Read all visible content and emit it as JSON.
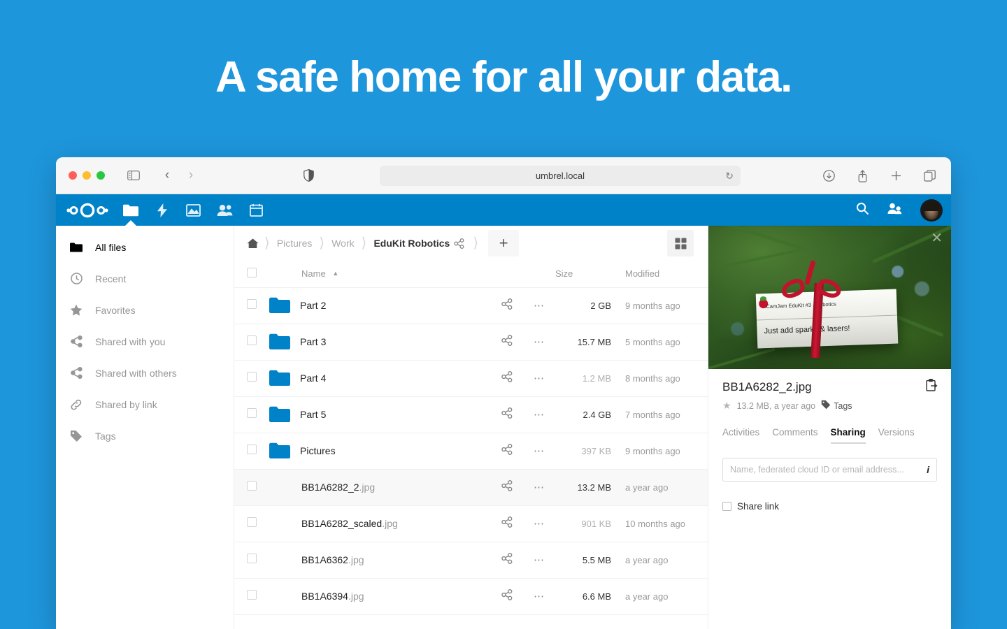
{
  "hero": {
    "title": "A safe home for all your data."
  },
  "browser": {
    "url": "umbrel.local",
    "traffic": [
      "close",
      "minimize",
      "zoom"
    ],
    "icons": {
      "sidebar": "sidebar-toggle-icon",
      "back": "back-arrow-icon",
      "forward": "forward-arrow-icon",
      "shield": "privacy-shield-icon",
      "reload": "reload-icon",
      "download": "download-icon",
      "share": "share-icon",
      "new_tab": "plus-icon",
      "tabs": "tab-overview-icon"
    }
  },
  "app_header": {
    "logo": "nextcloud-logo",
    "apps": [
      {
        "name": "files",
        "icon": "folder-icon",
        "active": true
      },
      {
        "name": "activity",
        "icon": "lightning-icon",
        "active": false
      },
      {
        "name": "photos",
        "icon": "picture-icon",
        "active": false
      },
      {
        "name": "contacts",
        "icon": "people-icon",
        "active": false
      },
      {
        "name": "calendar",
        "icon": "calendar-icon",
        "active": false
      }
    ],
    "right": [
      {
        "name": "search",
        "icon": "magnifier-icon"
      },
      {
        "name": "contacts-menu",
        "icon": "contacts-icon"
      },
      {
        "name": "user-avatar",
        "icon": "avatar"
      }
    ]
  },
  "sidebar": {
    "items": [
      {
        "label": "All files",
        "icon": "folder-icon",
        "active": true
      },
      {
        "label": "Recent",
        "icon": "clock-icon",
        "active": false
      },
      {
        "label": "Favorites",
        "icon": "star-icon",
        "active": false
      },
      {
        "label": "Shared with you",
        "icon": "share-icon",
        "active": false
      },
      {
        "label": "Shared with others",
        "icon": "share-icon",
        "active": false
      },
      {
        "label": "Shared by link",
        "icon": "link-icon",
        "active": false
      },
      {
        "label": "Tags",
        "icon": "tag-icon",
        "active": false
      }
    ]
  },
  "breadcrumb": {
    "home_icon": "home-icon",
    "crumbs": [
      "Pictures",
      "Work",
      "EduKit Robotics"
    ],
    "current": "EduKit Robotics",
    "share_icon": "share-icon",
    "new_label": "+",
    "grid_toggle": "grid-view-icon"
  },
  "filetable": {
    "headers": {
      "name": "Name",
      "size": "Size",
      "modified": "Modified"
    },
    "sort": {
      "column": "Name",
      "direction": "asc"
    },
    "rows": [
      {
        "name": "Part 2",
        "ext": "",
        "type": "folder",
        "size": "2 GB",
        "size_faded": false,
        "modified": "9 months ago",
        "selected": false
      },
      {
        "name": "Part 3",
        "ext": "",
        "type": "folder",
        "size": "15.7 MB",
        "size_faded": false,
        "modified": "5 months ago",
        "selected": false
      },
      {
        "name": "Part 4",
        "ext": "",
        "type": "folder",
        "size": "1.2 MB",
        "size_faded": true,
        "modified": "8 months ago",
        "selected": false
      },
      {
        "name": "Part 5",
        "ext": "",
        "type": "folder",
        "size": "2.4 GB",
        "size_faded": false,
        "modified": "7 months ago",
        "selected": false
      },
      {
        "name": "Pictures",
        "ext": "",
        "type": "folder",
        "size": "397 KB",
        "size_faded": true,
        "modified": "9 months ago",
        "selected": false
      },
      {
        "name": "BB1A6282_2",
        "ext": ".jpg",
        "type": "image",
        "size": "13.2 MB",
        "size_faded": false,
        "modified": "a year ago",
        "selected": true
      },
      {
        "name": "BB1A6282_scaled",
        "ext": ".jpg",
        "type": "image",
        "size": "901 KB",
        "size_faded": true,
        "modified": "10 months ago",
        "selected": false
      },
      {
        "name": "BB1A6362",
        "ext": ".jpg",
        "type": "image",
        "size": "5.5 MB",
        "size_faded": false,
        "modified": "a year ago",
        "selected": false
      },
      {
        "name": "BB1A6394",
        "ext": ".jpg",
        "type": "image",
        "size": "6.6 MB",
        "size_faded": false,
        "modified": "a year ago",
        "selected": false
      }
    ],
    "row_icons": {
      "share": "share-icon",
      "menu": "more-actions-icon"
    }
  },
  "details": {
    "preview": {
      "alt": "gift box on evergreen branches",
      "label_top": "CamJam EduKit #3 - Robotics",
      "label_bottom": "Just add sparks & lasers!",
      "close_icon": "close-icon"
    },
    "filename": "BB1A6282_2.jpg",
    "favorite_icon": "star-icon",
    "meta": "13.2 MB, a year ago",
    "tags_label": "Tags",
    "tags_icon": "tag-icon",
    "copy_icon": "copy-to-clipboard-icon",
    "tabs": [
      {
        "label": "Activities",
        "active": false
      },
      {
        "label": "Comments",
        "active": false
      },
      {
        "label": "Sharing",
        "active": true
      },
      {
        "label": "Versions",
        "active": false
      }
    ],
    "share_placeholder": "Name, federated cloud ID or email address...",
    "share_value": "",
    "info_icon": "info-icon",
    "share_link_label": "Share link",
    "share_link_checked": false
  },
  "colors": {
    "background": "#1e96dc",
    "header": "#0082c9",
    "folder": "#0082c9",
    "selected_row": "#f8f8f8"
  }
}
